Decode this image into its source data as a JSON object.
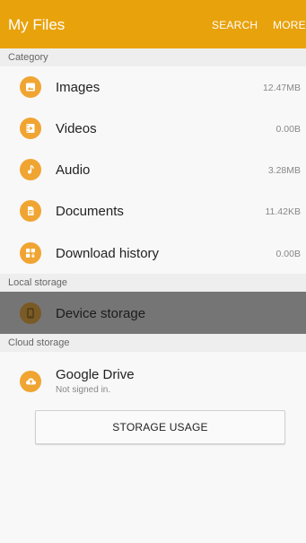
{
  "appbar": {
    "title": "My Files",
    "search_label": "SEARCH",
    "more_label": "MORE",
    "color": "#e8a20c"
  },
  "sections": {
    "category": "Category",
    "local_storage": "Local storage",
    "cloud_storage": "Cloud storage"
  },
  "category_items": [
    {
      "label": "Images",
      "size": "12.47MB",
      "icon": "image-icon"
    },
    {
      "label": "Videos",
      "size": "0.00B",
      "icon": "video-icon"
    },
    {
      "label": "Audio",
      "size": "3.28MB",
      "icon": "music-note-icon"
    },
    {
      "label": "Documents",
      "size": "11.42KB",
      "icon": "document-icon"
    },
    {
      "label": "Download history",
      "size": "0.00B",
      "icon": "download-history-icon"
    }
  ],
  "local_items": [
    {
      "label": "Device storage",
      "icon": "device-storage-icon"
    }
  ],
  "cloud_items": [
    {
      "label": "Google Drive",
      "sublabel": "Not signed in.",
      "icon": "cloud-upload-icon"
    }
  ],
  "storage_button_label": "STORAGE USAGE",
  "icon_color": "#f0a532"
}
